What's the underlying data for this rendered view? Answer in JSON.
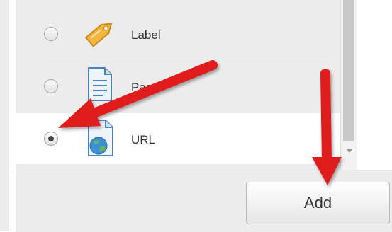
{
  "modules": [
    {
      "label": "Label",
      "icon": "label-tag-icon",
      "selected": false
    },
    {
      "label": "Page",
      "icon": "page-document-icon",
      "selected": false
    },
    {
      "label": "URL",
      "icon": "url-globe-document-icon",
      "selected": true
    }
  ],
  "footer": {
    "add_label": "Add"
  },
  "colors": {
    "annotation_arrow": "#e01b1b",
    "panel_bg": "#ececec",
    "selected_bg": "#ffffff"
  }
}
